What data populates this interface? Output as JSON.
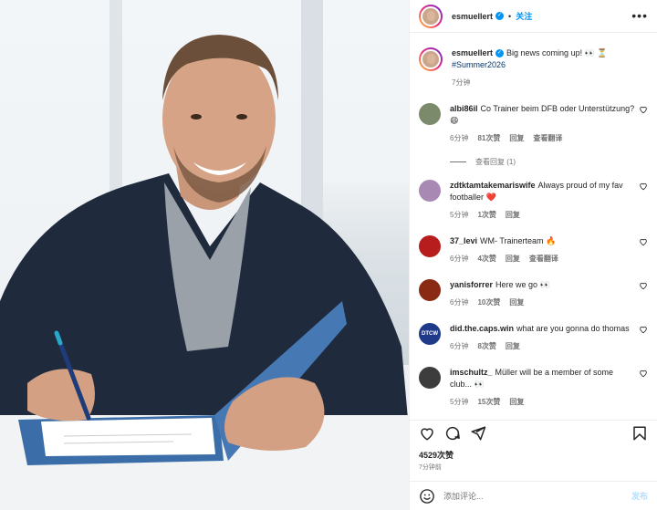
{
  "header": {
    "username": "esmuellert",
    "follow_label": "关注",
    "more_label": "•••"
  },
  "caption": {
    "username": "esmuellert",
    "text": "Big news coming up! 👀 ⏳",
    "hashtag": "#Summer2026",
    "time": "7分钟"
  },
  "comments": [
    {
      "username": "albi86il",
      "text": "Co Trainer beim DFB oder Unterstützung? 😄",
      "time": "6分钟",
      "likes": "81次赞",
      "reply": "回复",
      "translate": "查看翻译",
      "avatar_color": "#7a8a6a"
    },
    {
      "username": "zdtktamtakemariswife",
      "text": "Always proud of my fav footballer ❤️",
      "time": "5分钟",
      "likes": "1次赞",
      "reply": "回复",
      "translate": "",
      "avatar_color": "#a889b4"
    },
    {
      "username": "37_levi",
      "text": "WM- Trainerteam 🔥",
      "time": "6分钟",
      "likes": "4次赞",
      "reply": "回复",
      "translate": "查看翻译",
      "avatar_color": "#b81d1d"
    },
    {
      "username": "yanisforrer",
      "text": "Here we go 👀",
      "time": "6分钟",
      "likes": "10次赞",
      "reply": "回复",
      "translate": "",
      "avatar_color": "#8a2a14"
    },
    {
      "username": "did.the.caps.win",
      "text": "what are you gonna do thomas",
      "time": "6分钟",
      "likes": "8次赞",
      "reply": "回复",
      "translate": "",
      "avatar_color": "#1f3a8a",
      "avatar_text": "DTCW"
    },
    {
      "username": "imschultz_",
      "text": "Müller will be a member of some club... 👀",
      "time": "5分钟",
      "likes": "15次赞",
      "reply": "回复",
      "translate": "",
      "avatar_color": "#3d3d3d"
    }
  ],
  "view_replies": "查看回复 (1)",
  "likes_total": "4529次赞",
  "posted_ago": "7分钟前",
  "comment_box": {
    "placeholder": "添加评论...",
    "post_label": "发布"
  },
  "colors": {
    "accent": "#0095f6",
    "post_disabled": "#b2dffc",
    "muted": "#737373"
  },
  "icons": [
    "heart-icon",
    "comment-icon",
    "share-icon",
    "bookmark-icon",
    "emoji-icon",
    "verified-icon"
  ]
}
